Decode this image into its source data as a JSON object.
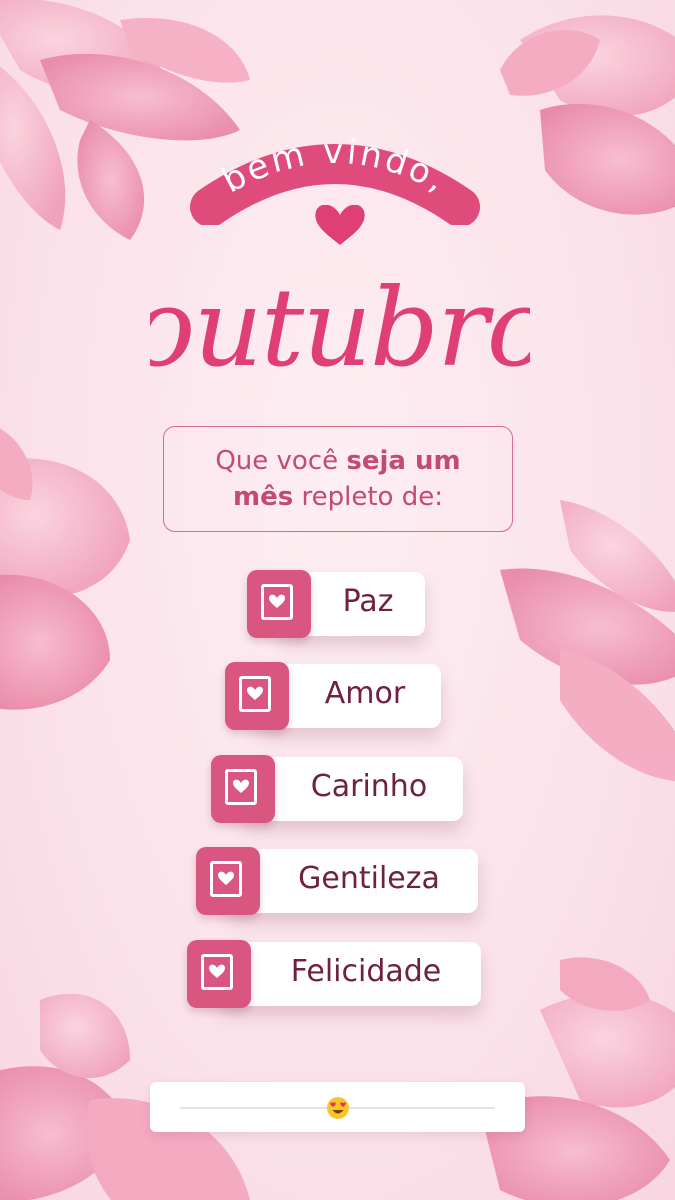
{
  "greeting": "bem vindo,",
  "title": "outubro",
  "subtitle": {
    "line1_regular": "Que você ",
    "line1_bold": "seja um",
    "line2_bold": "mês",
    "line2_regular": " repleto de:"
  },
  "wishes": [
    {
      "label": "Paz"
    },
    {
      "label": "Amor"
    },
    {
      "label": "Carinho"
    },
    {
      "label": "Gentileza"
    },
    {
      "label": "Felicidade"
    }
  ],
  "slider": {
    "value_percent": 50,
    "thumb_icon": "heart-eyes-emoji-icon"
  },
  "colors": {
    "background": "#fbe3ea",
    "accent": "#d8567f",
    "title": "#df3f75",
    "text": "#6e2140",
    "subtitle": "#c24a74"
  }
}
